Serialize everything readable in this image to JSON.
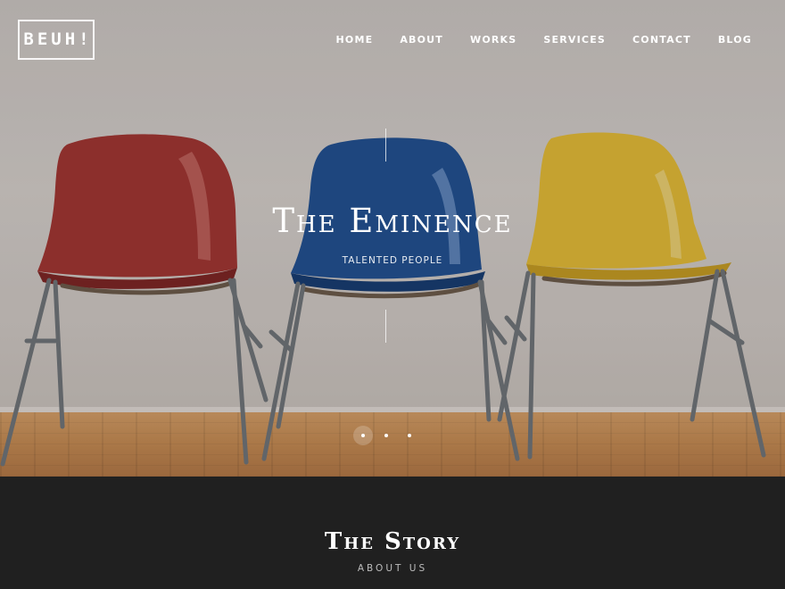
{
  "header": {
    "logo_text": "BEUH!",
    "nav": [
      {
        "label": "HOME"
      },
      {
        "label": "ABOUT"
      },
      {
        "label": "WORKS"
      },
      {
        "label": "SERVICES"
      },
      {
        "label": "CONTACT"
      },
      {
        "label": "BLOG"
      }
    ]
  },
  "hero": {
    "title": "The Eminence",
    "subtitle": "TALENTED PEOPLE",
    "slides": 3,
    "active_slide": 1,
    "image": {
      "subject": "three plastic chairs against a wall",
      "colors": {
        "left": "#a3322f",
        "middle": "#1d4f93",
        "right": "#e8bf34"
      }
    }
  },
  "story": {
    "title": "The Story",
    "subtitle": "ABOUT US"
  }
}
